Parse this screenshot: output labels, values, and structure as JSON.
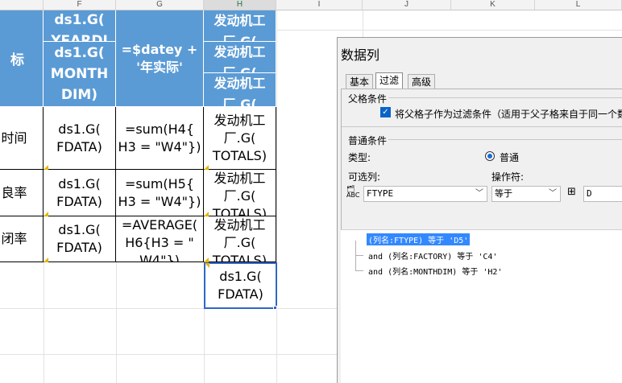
{
  "columns": [
    "F",
    "G",
    "H",
    "I",
    "J",
    "K",
    "L"
  ],
  "active_column": "H",
  "row_labels": [
    "标",
    "时间",
    "良率",
    "闭率"
  ],
  "cells": {
    "f_head_top": "ds1.G(\nYEARDI",
    "f_head_bottom": "ds1.G(\nMONTH\nDIM)",
    "g_head": "=$datey +\n'年实际'",
    "h_head_1": "发动机工\n厂.G(",
    "h_head_2": "发动机工\n厂.G(",
    "h_head_3": "发动机工\n厂.G(",
    "f_r1": "ds1.G(\nFDATA)",
    "g_r1": "=sum(H4{\nH3 = \"W4\"})",
    "h_r1": "发动机工\n厂.G(\nTOTALS)",
    "f_r2": "ds1.G(\nFDATA)",
    "g_r2": "=sum(H5{\nH3 = \"W4\"})",
    "h_r2": "发动机工\n厂.G(\nTOTALS)",
    "f_r3": "ds1.G(\nFDATA)",
    "g_r3": "=AVERAGE(\nH6{H3 = \"\nW4\"})",
    "h_r3": "发动机工\n厂.G(\nTOTALS)",
    "h_r4": "ds1.G(\nFDATA)"
  },
  "dialog": {
    "title": "数据列",
    "tabs": [
      "基本",
      "过滤",
      "高级"
    ],
    "active_tab": "过滤",
    "parent_section": "父格条件",
    "parent_checkbox_label": "将父格子作为过滤条件（适用于父子格来自于同一个数据",
    "general_section": "普通条件",
    "type_label": "类型:",
    "type_option": "普通",
    "optional_label": "可选列:",
    "operator_label": "操作符:",
    "column_value": "FTYPE",
    "operator_value": "等于",
    "value_text": "D",
    "conditions": [
      "(列名:FTYPE) 等于 'D5'",
      "and (列名:FACTORY) 等于 'C4'",
      "and (列名:MONTHDIM) 等于 'H2'"
    ]
  },
  "colors": {
    "header_blue": "#5b9bd5",
    "selection": "#2f66c8",
    "highlight": "#3388ff"
  }
}
